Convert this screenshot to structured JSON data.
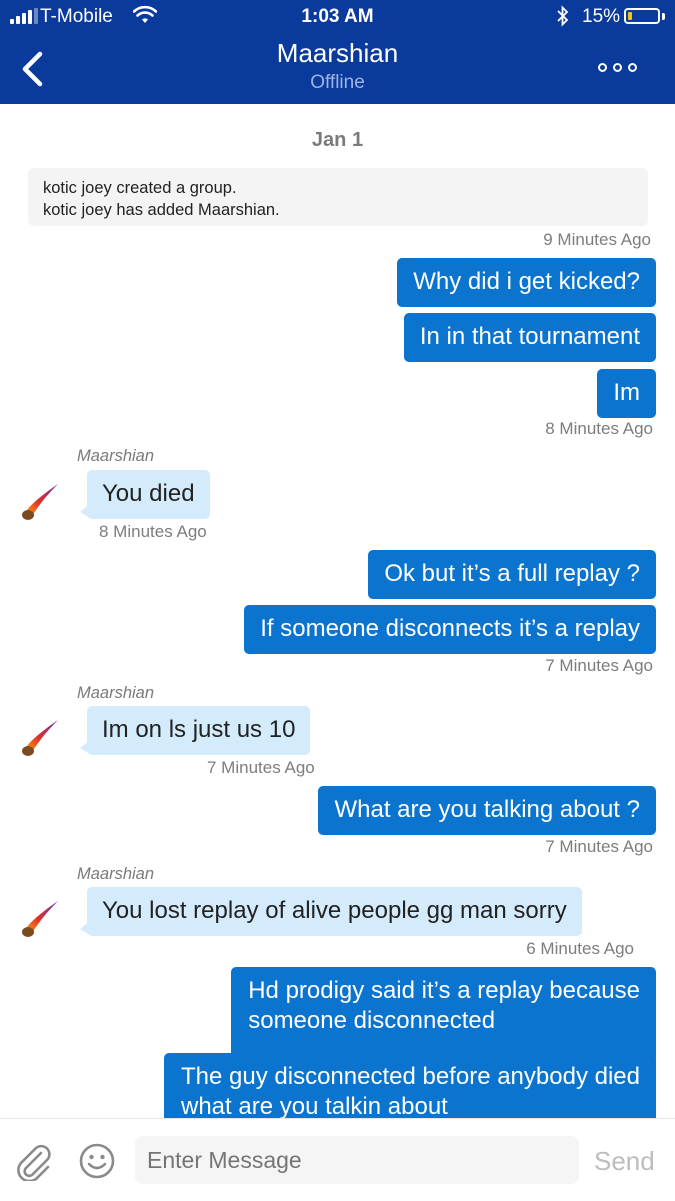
{
  "status_bar": {
    "carrier": "T-Mobile",
    "time": "1:03 AM",
    "battery": "15%",
    "battery_level": 0.15
  },
  "header": {
    "title": "Maarshian",
    "subtitle": "Offline"
  },
  "chat": {
    "date": "Jan 1",
    "system_lines": [
      "kotic joey created a group.",
      "kotic joey has added Maarshian."
    ],
    "system_time": "9 Minutes Ago",
    "messages": [
      {
        "dir": "out",
        "text": "Why did i get kicked?"
      },
      {
        "dir": "out",
        "text": "In in that tournament"
      },
      {
        "dir": "out",
        "text": "Im"
      },
      {
        "dir": "out_time",
        "time": "8 Minutes Ago"
      },
      {
        "dir": "in",
        "sender": "Maarshian",
        "text": "You died",
        "time": "8 Minutes Ago"
      },
      {
        "dir": "out",
        "text": "Ok but it’s a full replay ?"
      },
      {
        "dir": "out",
        "text": "If someone disconnects it’s a replay"
      },
      {
        "dir": "out_time",
        "time": "7 Minutes Ago"
      },
      {
        "dir": "in",
        "sender": "Maarshian",
        "text": "Im on ls just us 10",
        "time": "7 Minutes Ago"
      },
      {
        "dir": "out",
        "text": "What are you talking about ?"
      },
      {
        "dir": "out_time",
        "time": "7 Minutes Ago"
      },
      {
        "dir": "in",
        "sender": "Maarshian",
        "text": "You lost replay of alive people gg man sorry",
        "time": "6 Minutes Ago"
      },
      {
        "dir": "out",
        "lines": [
          "Hd prodigy said it’s a replay because",
          "someone disconnected"
        ]
      },
      {
        "dir": "out",
        "lines": [
          "The guy disconnected before anybody died",
          "what are you talkin about"
        ]
      }
    ]
  },
  "composer": {
    "placeholder": "Enter Message",
    "send_label": "Send"
  },
  "colors": {
    "header_bg": "#0a3b9c",
    "outgoing_bubble": "#0a74cf",
    "incoming_bubble": "#d3ebfb"
  },
  "icons": [
    "signal-icon",
    "wifi-icon",
    "bluetooth-icon",
    "battery-icon",
    "back-chevron-icon",
    "more-options-icon",
    "meteor-avatar-icon",
    "paperclip-icon",
    "emoji-icon"
  ]
}
